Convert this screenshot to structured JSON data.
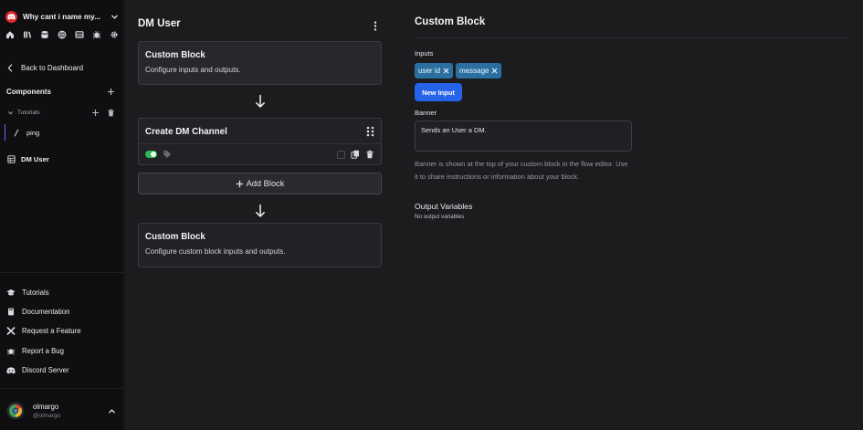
{
  "sidebar": {
    "server_name": "Why cant i name my...",
    "quick_icons": [
      "home-icon",
      "library-icon",
      "database-icon",
      "globe-icon",
      "table-icon",
      "bug-icon",
      "gear-icon"
    ],
    "back_label": "Back to Dashboard",
    "components_label": "Components",
    "folder_label": "Tutorials",
    "items": [
      {
        "label": "ping",
        "icon": "slash-icon"
      },
      {
        "label": "DM User",
        "icon": "grid-icon"
      }
    ],
    "bottom_links": [
      {
        "label": "Tutorials",
        "icon": "graduation-cap-icon"
      },
      {
        "label": "Documentation",
        "icon": "book-icon"
      },
      {
        "label": "Request a Feature",
        "icon": "tools-icon"
      },
      {
        "label": "Report a Bug",
        "icon": "bug-icon"
      },
      {
        "label": "Discord Server",
        "icon": "discord-icon"
      }
    ],
    "user": {
      "name": "olmargo",
      "handle": "@olmargo"
    }
  },
  "main": {
    "title": "DM User",
    "blocks": {
      "first": {
        "title": "Custom Block",
        "subtitle": "Configure inputs and outputs."
      },
      "dm": {
        "title": "Create DM Channel",
        "enabled": true
      },
      "add_label": "Add Block",
      "last": {
        "title": "Custom Block",
        "subtitle": "Configure custom block inputs and outputs."
      }
    }
  },
  "panel": {
    "title": "Custom Block",
    "inputs_label": "Inputs",
    "inputs": [
      "user id",
      "message"
    ],
    "new_input_label": "New Input",
    "banner_label": "Banner",
    "banner_value": "Sends an User a DM.",
    "help_text": "Banner is shown at the top of your custom block in the flow editor. Use it to share instructions or information about your block.",
    "output_title": "Output Variables",
    "output_empty": "No output variables"
  },
  "colors": {
    "accent": "#2563eb",
    "chip": "#2a6f9f",
    "toggle_on": "#2fb55a",
    "server_logo": "#e02a2a",
    "active_item": "#7c5cff"
  }
}
